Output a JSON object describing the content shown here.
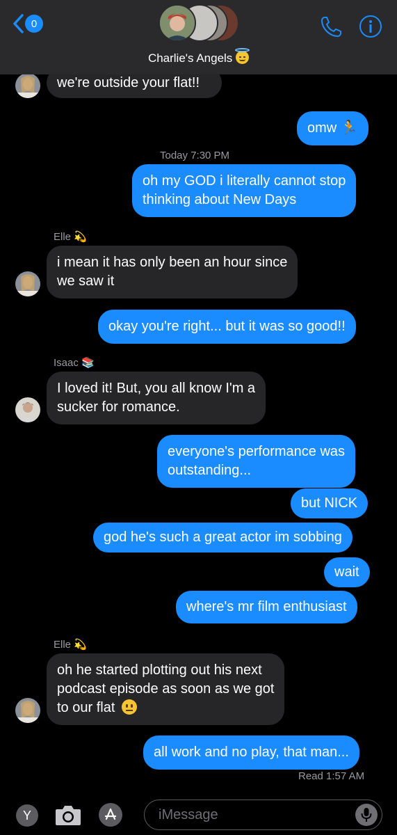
{
  "header": {
    "back_badge": "0",
    "group_name": "Charlie's Angels",
    "group_emoji": "smiling-face-with-halo",
    "icons": [
      "chevron-left-icon",
      "phone-icon",
      "info-icon"
    ]
  },
  "messages": {
    "m1": {
      "text": "we're outside your flat!!",
      "direction": "incoming"
    },
    "m2": {
      "text": "omw 🏃",
      "direction": "outgoing"
    },
    "timestamp_today": "Today 7:30 PM",
    "m3": {
      "line1": "oh my GOD i literally cannot stop",
      "line2": "thinking about New Days",
      "direction": "outgoing"
    },
    "sender_elle_1": "Elle 💫",
    "m4": {
      "line1": "i mean it has only been an hour since",
      "line2": "we saw it",
      "direction": "incoming"
    },
    "m5": {
      "text": "okay you're right... but it was so good!!",
      "direction": "outgoing"
    },
    "sender_isaac": "Isaac 📚",
    "m6": {
      "line1": "I loved it! But, you all know I'm a",
      "line2": "sucker for romance.",
      "direction": "incoming"
    },
    "m7": {
      "line1": "everyone's performance was",
      "line2": "outstanding...",
      "direction": "outgoing"
    },
    "m8": {
      "text": "but NICK",
      "direction": "outgoing"
    },
    "m9": {
      "text": "god he's such a great actor im sobbing",
      "direction": "outgoing"
    },
    "m10": {
      "text": "wait",
      "direction": "outgoing"
    },
    "m11": {
      "text": "where's mr film enthusiast",
      "direction": "outgoing"
    },
    "sender_elle_2": "Elle 💫",
    "m12": {
      "line1": "oh he started plotting out his next",
      "line2": "podcast episode as soon as we got",
      "line3": "to our flat",
      "direction": "incoming"
    },
    "m13": {
      "text": "all work and no play, that man...",
      "direction": "outgoing"
    },
    "read_receipt": "Read 1:57 AM"
  },
  "composer": {
    "placeholder": "iMessage",
    "left_badge": "Y",
    "icons": [
      "camera-icon",
      "app-store-icon",
      "microphone-icon"
    ]
  },
  "colors": {
    "outgoing_bubble": "#1a8cff",
    "incoming_bubble": "#262628",
    "background": "#000000",
    "header_background": "#2a2a2c"
  }
}
